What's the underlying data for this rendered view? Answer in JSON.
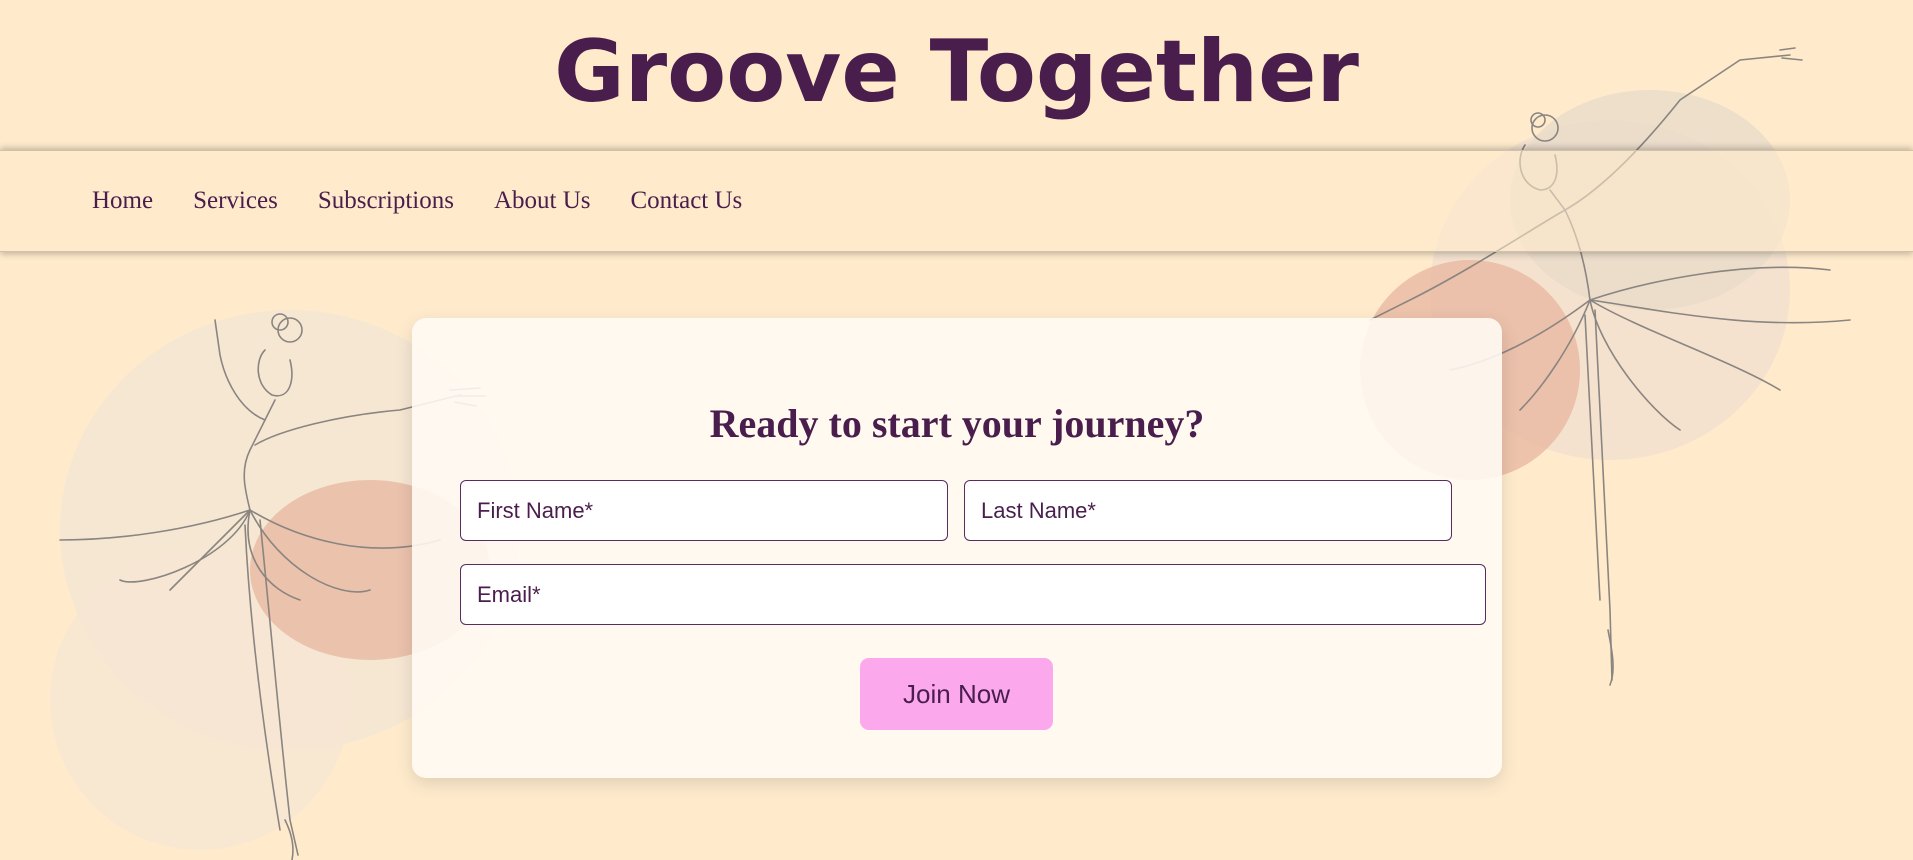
{
  "site": {
    "title": "Groove Together"
  },
  "nav": {
    "items": [
      {
        "label": "Home"
      },
      {
        "label": "Services"
      },
      {
        "label": "Subscriptions"
      },
      {
        "label": "About Us"
      },
      {
        "label": "Contact Us"
      }
    ]
  },
  "signup": {
    "heading": "Ready to start your journey?",
    "first_name": {
      "placeholder": "First Name*",
      "value": ""
    },
    "last_name": {
      "placeholder": "Last Name*",
      "value": ""
    },
    "email": {
      "placeholder": "Email*",
      "value": ""
    },
    "submit_label": "Join Now"
  },
  "colors": {
    "background": "#FFEBCC",
    "primary_text": "#4A1E4C",
    "button": "#FBA8EC",
    "card": "#FFFBF5"
  },
  "decorations": {
    "left_illustration": "ballerina-line-art",
    "right_illustration": "ballerina-line-art"
  }
}
